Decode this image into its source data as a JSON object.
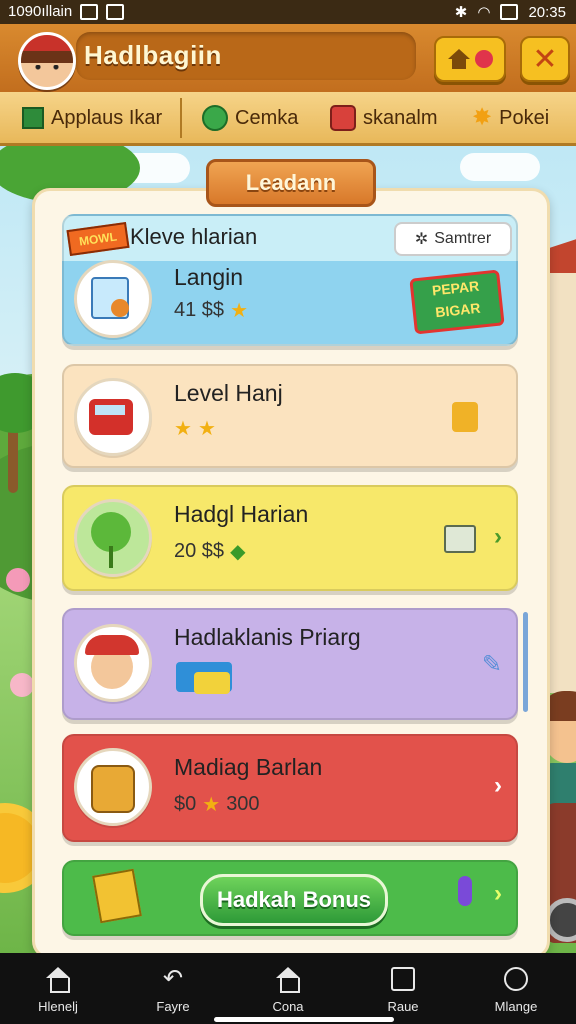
{
  "status_bar": {
    "left_text": "1090ıllain",
    "time": "20:35"
  },
  "header": {
    "title": "Hadlbagiin"
  },
  "tabs": [
    {
      "label": "Applaus Ikar",
      "icon": "grid-icon"
    },
    {
      "label": "Cemka",
      "icon": "globe-icon"
    },
    {
      "label": "skanalm",
      "icon": "gift-icon"
    },
    {
      "label": "Pokei",
      "icon": "star-icon"
    }
  ],
  "panel": {
    "title": "Leadann"
  },
  "banner": {
    "tag": "MOWL",
    "title": "Kleve hlarian",
    "button": "Samtrer",
    "item_name": "Langin",
    "item_score": "41 $$",
    "reward_text": "PEPAR BIGAR"
  },
  "list": [
    {
      "name": "Level Hanj",
      "value": ""
    },
    {
      "name": "Hadgl Harian",
      "value": "20 $$"
    },
    {
      "name": "Hadlaklanis Priarg",
      "value": ""
    },
    {
      "name": "Madiag Barlan",
      "value": "$0",
      "value2": "300"
    }
  ],
  "bonus_button": "Hadkah Bonus",
  "bottom_nav": [
    "Hlenelj",
    "Fayre",
    "Cona",
    "Raue",
    "Mlange"
  ],
  "colors": {
    "header": "#c26e1e",
    "accent": "#f6c021",
    "bonus": "#4dbb4a"
  }
}
